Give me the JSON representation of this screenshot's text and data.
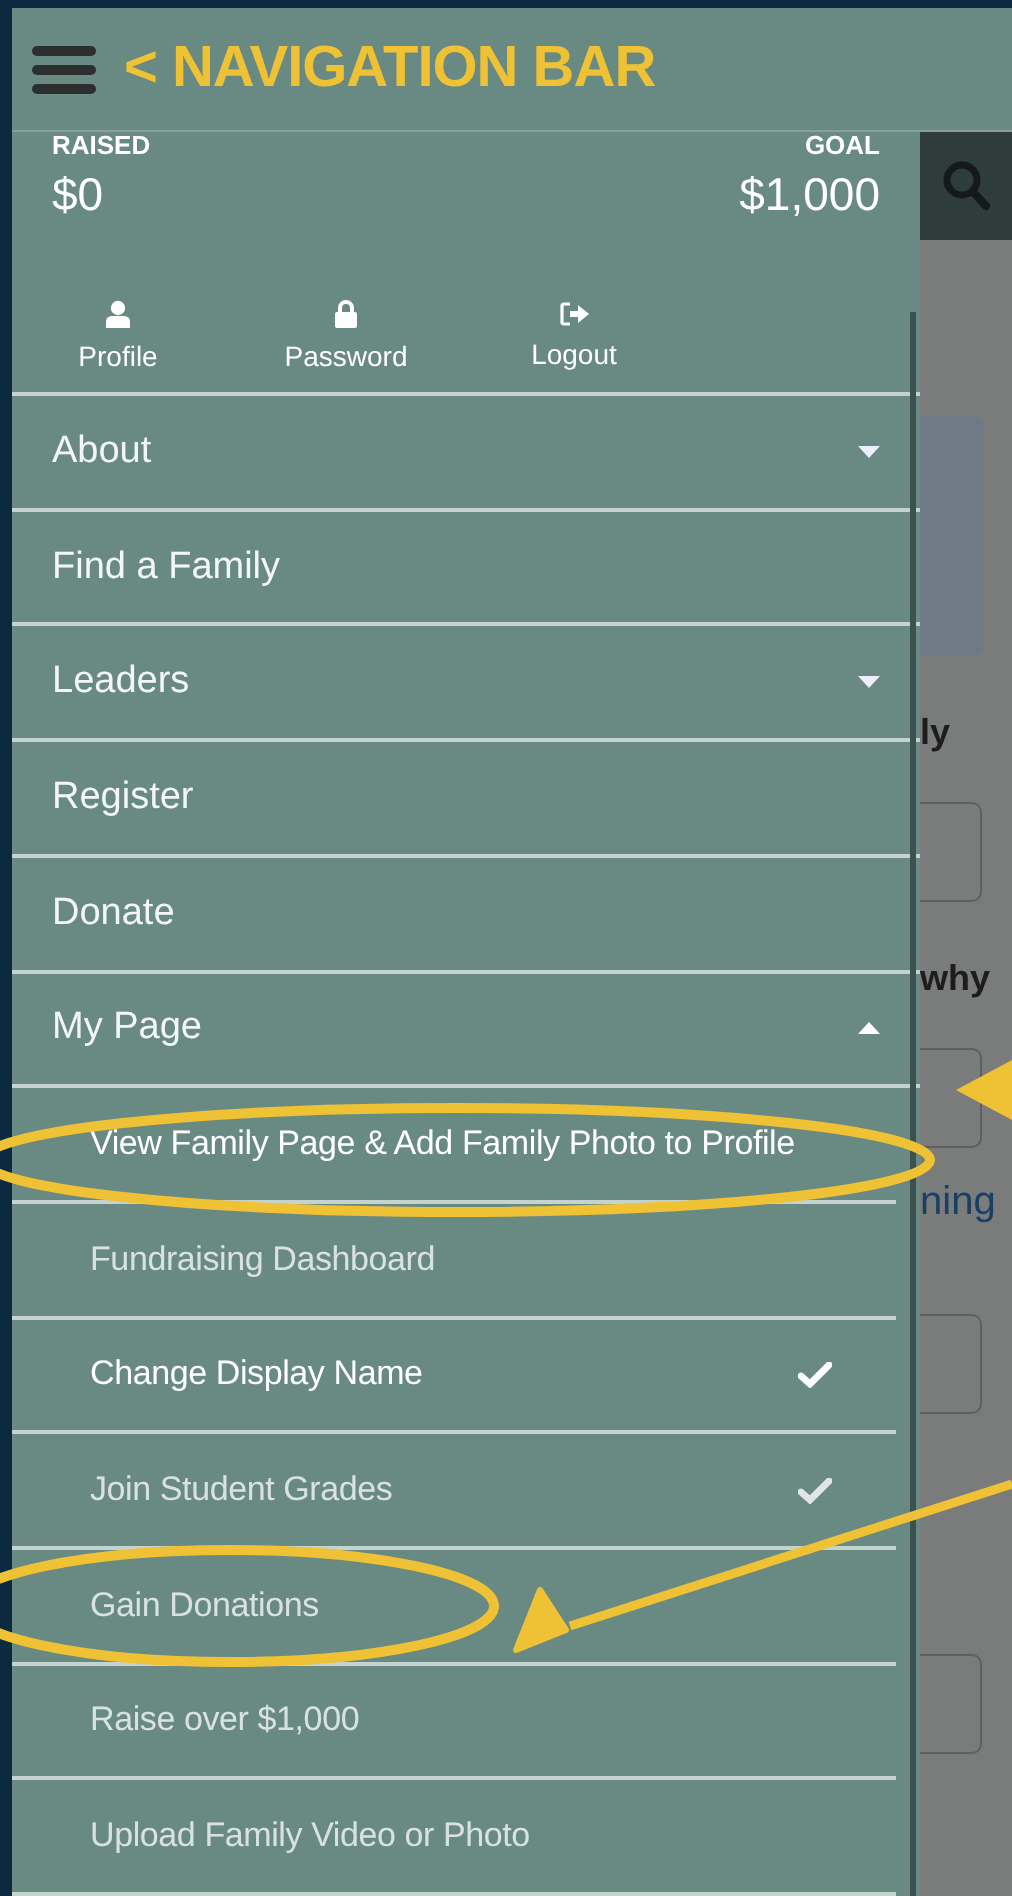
{
  "annotation_title": "< NAVIGATION BAR",
  "stats": {
    "raised_label": "RAISED",
    "raised": "$0",
    "goal_label": "GOAL",
    "goal": "$1,000"
  },
  "account_links": [
    {
      "kind": "profile",
      "label": "Profile"
    },
    {
      "kind": "password",
      "label": "Password"
    },
    {
      "kind": "logout",
      "label": "Logout"
    }
  ],
  "menu": [
    {
      "label": "About",
      "expanded": false
    },
    {
      "label": "Find a Family"
    },
    {
      "label": "Leaders",
      "expanded": false
    },
    {
      "label": "Register"
    },
    {
      "label": "Donate"
    },
    {
      "label": "My Page",
      "expanded": true,
      "children": [
        {
          "label": "View Family Page & Add Family Photo to Profile",
          "emphasized": true,
          "checked": false
        },
        {
          "label": "Fundraising Dashboard",
          "emphasized": false,
          "checked": false
        },
        {
          "label": "Change Display Name",
          "emphasized": true,
          "checked": true
        },
        {
          "label": "Join Student Grades",
          "emphasized": false,
          "checked": true
        },
        {
          "label": "Gain Donations",
          "emphasized": false,
          "checked": false
        },
        {
          "label": "Raise over $1,000",
          "emphasized": false,
          "checked": false
        },
        {
          "label": "Upload Family Video or Photo",
          "emphasized": false,
          "checked": false
        }
      ]
    }
  ],
  "background_page": {
    "fragments": [
      {
        "kind": "heading",
        "text": "ly"
      },
      {
        "kind": "heading",
        "text": "why"
      },
      {
        "kind": "link",
        "text": "ning"
      }
    ]
  }
}
